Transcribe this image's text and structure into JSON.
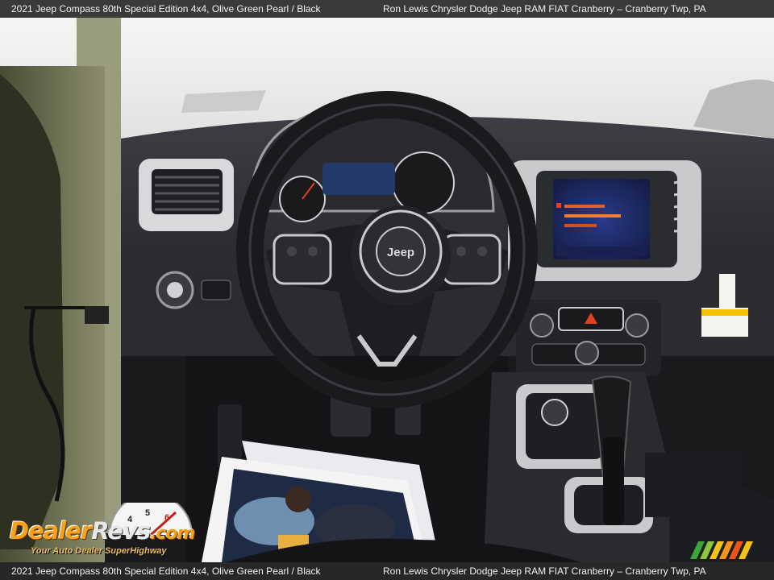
{
  "header": {
    "left": "2021 Jeep Compass 80th Special Edition 4x4,   Olive Green Pearl / Black",
    "right": "Ron Lewis Chrysler Dodge Jeep RAM FIAT Cranberry – Cranberry Twp, PA"
  },
  "footer": {
    "left": "2021 Jeep Compass 80th Special Edition 4x4,   Olive Green Pearl / Black",
    "right": "Ron Lewis Chrysler Dodge Jeep RAM FIAT Cranberry – Cranberry Twp, PA"
  },
  "watermark": {
    "brand_part1": "Dealer",
    "brand_part2": "Revs",
    "brand_part3": ".com",
    "tagline": "Your Auto Dealer SuperHighway"
  },
  "photo": {
    "wheel_badge": "Jeep"
  }
}
